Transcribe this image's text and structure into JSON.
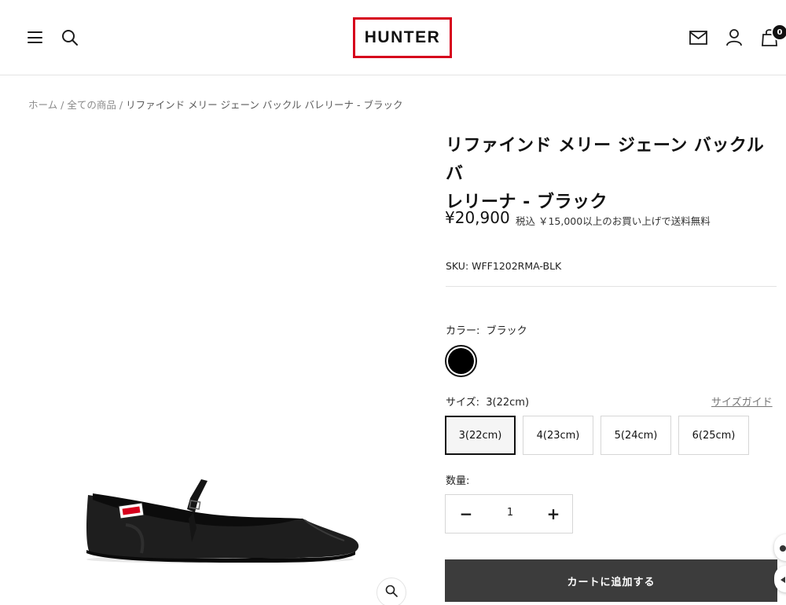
{
  "header": {
    "logo_text": "HUNTER",
    "cart_count": "0",
    "icons": [
      "hamburger-menu-icon",
      "search-icon",
      "mail-icon",
      "account-icon",
      "cart-icon"
    ],
    "brand_color": "#d6001c"
  },
  "breadcrumb": {
    "home": "ホーム",
    "all_products": "全ての商品",
    "current": "リファインド メリー ジェーン バックル バレリーナ - ブラック",
    "separator": "/"
  },
  "product": {
    "title_line1": "リファインド メリー ジェーン バックル バ",
    "title_line2": "レリーナ - ブラック",
    "price": "¥20,900",
    "tax_note": "税込 ￥15,000以上のお買い上げで送料無料",
    "sku": "SKU: WFF1202RMA-BLK",
    "color_label": "カラー:",
    "color_value": "ブラック",
    "swatch_color": "#000000",
    "size_label": "サイズ:",
    "size_value": "3(22cm)",
    "size_guide": "サイズガイド",
    "sizes": [
      "3(22cm)",
      "4(23cm)",
      "5(24cm)",
      "6(25cm)"
    ],
    "selected_size_index": 0,
    "qty_label": "数量:",
    "qty_value": "1",
    "qty_minus": "−",
    "qty_plus": "+",
    "add_to_cart": "カートに追加する",
    "button_color": "#3c3c3c"
  }
}
